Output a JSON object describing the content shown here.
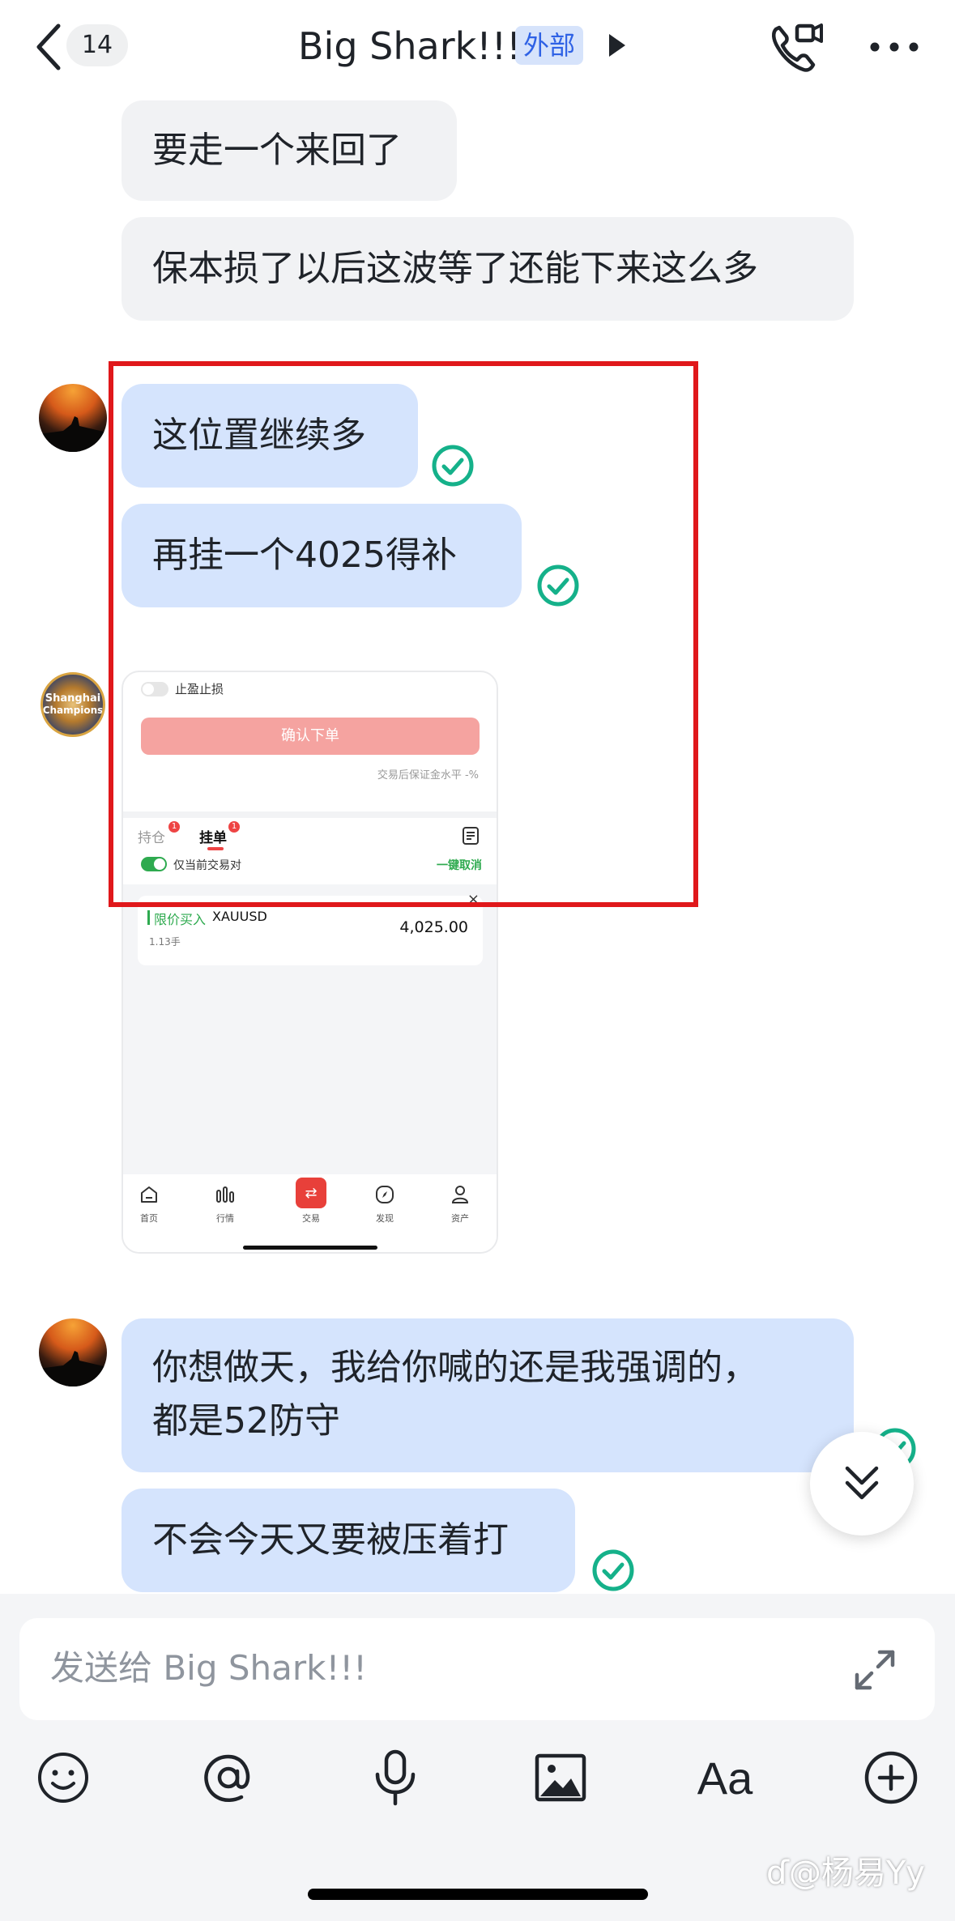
{
  "header": {
    "back_count": "14",
    "title": "Big Shark!!!",
    "external_tag": "外部",
    "icons": [
      "back-arrow-icon",
      "triangle-right-icon",
      "video-call-icon",
      "more-icon"
    ]
  },
  "messages": [
    {
      "text": "要走一个来回了"
    },
    {
      "text": "保本损了以后这波等了还能下来这么多"
    },
    {
      "text": "这位置继续多"
    },
    {
      "text": "再挂一个4025得补"
    },
    {
      "line1": "你想做天，我给你喊的还是我强调的，",
      "line2": "都是52防守"
    },
    {
      "text": "不会今天又要被压着打"
    }
  ],
  "avatar_team": {
    "line1": "Shanghai",
    "line2": "Champions"
  },
  "screenshot": {
    "toggle_label": "止盈止损",
    "confirm_button": "确认下单",
    "margin_note": "交易后保证金水平 -%",
    "tab_positions": "持仓",
    "tab_positions_badge": "1",
    "tab_orders": "挂单",
    "tab_orders_badge": "1",
    "current_pair_toggle": "仅当前交易对",
    "cancel_all": "一键取消",
    "order_type": "限价买入",
    "order_symbol": "XAUUSD",
    "order_size": "1.13手",
    "order_price": "4,025.00",
    "close_mark": "×",
    "nav": [
      "首页",
      "行情",
      "交易",
      "发现",
      "资产"
    ]
  },
  "input": {
    "placeholder": "发送给 Big Shark!!!"
  },
  "toolbar": {
    "icons": [
      "emoji-icon",
      "mention-icon",
      "microphone-icon",
      "image-icon",
      "text-format-icon",
      "plus-icon"
    ],
    "text_format_label": "Aa"
  },
  "watermark": "@杨易Yy",
  "colors": {
    "accent_blue": "#3370ff",
    "bubble_blue": "#d5e4fd",
    "bubble_grey": "#f1f2f4",
    "check_green": "#15b18a",
    "highlight_red": "#e0181b"
  }
}
